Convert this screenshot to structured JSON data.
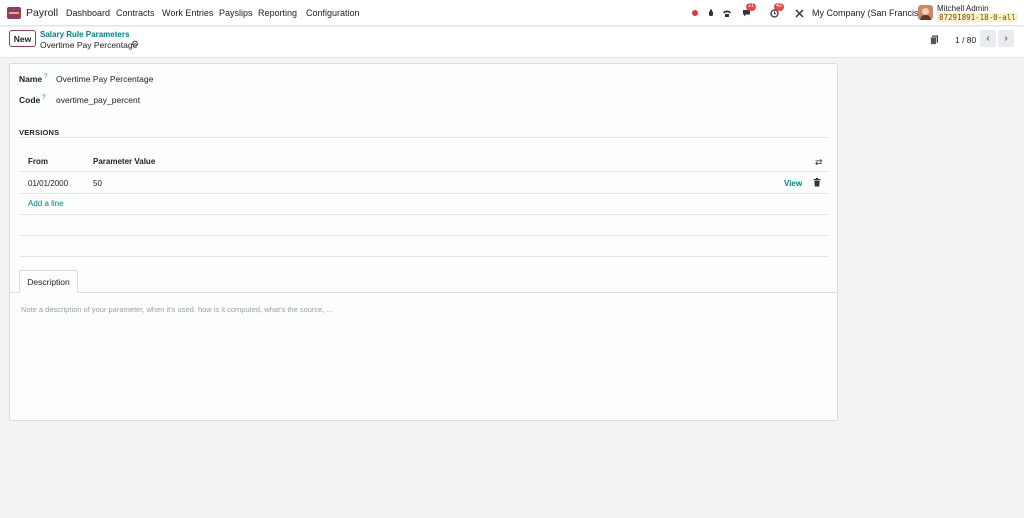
{
  "navbar": {
    "app_name": "Payroll",
    "menu": [
      "Dashboard",
      "Contracts",
      "Work Entries",
      "Payslips",
      "Reporting",
      "Configuration"
    ],
    "messages_count": "21",
    "activities_count": "42",
    "company": "My Company (San Francisco)",
    "user_name": "Mitchell Admin",
    "db_name": "87291891-18-0-all"
  },
  "control": {
    "new_label": "New",
    "breadcrumb_parent": "Salary Rule Parameters",
    "breadcrumb_current": "Overtime Pay Percentage",
    "pager": "1 / 80"
  },
  "form": {
    "name_label": "Name",
    "name_value": "Overtime Pay Percentage",
    "code_label": "Code",
    "code_value": "overtime_pay_percent",
    "help_marker": "?",
    "versions_title": "VERSIONS",
    "columns": [
      "From",
      "Parameter Value"
    ],
    "rows": [
      {
        "from": "01/01/2000",
        "value": "50",
        "view": "View"
      }
    ],
    "add_line": "Add a line",
    "tab_description": "Description",
    "description_placeholder": "Note a description of your parameter, when it's used, how is it computed, what's the source, ..."
  },
  "colors": {
    "brand": "#8f3d66",
    "link": "#017e84"
  }
}
